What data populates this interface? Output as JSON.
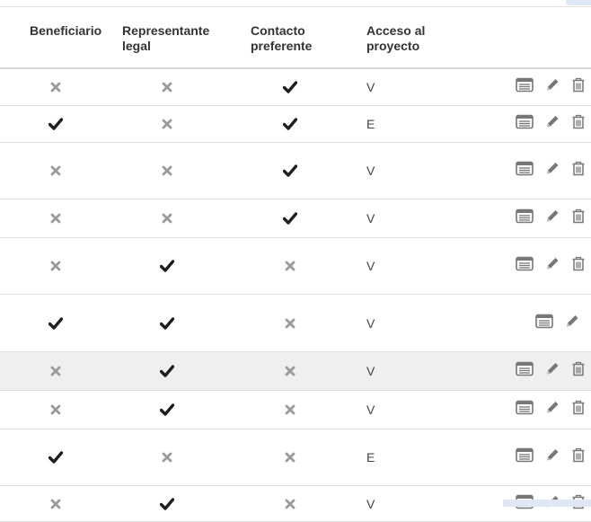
{
  "table": {
    "headers": {
      "beneficiario": "Beneficiario",
      "representante_line1": "Representante",
      "representante_line2": "legal",
      "contacto_line1": "Contacto",
      "contacto_line2": "preferente",
      "acceso_line1": "Acceso al",
      "acceso_line2": "proyecto"
    },
    "rows": [
      {
        "beneficiario": false,
        "representante": false,
        "contacto": true,
        "acceso": "V",
        "icons": [
          "list",
          "edit",
          "delete"
        ],
        "highlight": false
      },
      {
        "beneficiario": true,
        "representante": false,
        "contacto": true,
        "acceso": "E",
        "icons": [
          "list",
          "edit",
          "delete"
        ],
        "highlight": false
      },
      {
        "beneficiario": false,
        "representante": false,
        "contacto": true,
        "acceso": "V",
        "icons": [
          "list",
          "edit",
          "delete"
        ],
        "highlight": false
      },
      {
        "beneficiario": false,
        "representante": false,
        "contacto": true,
        "acceso": "V",
        "icons": [
          "list",
          "edit",
          "delete"
        ],
        "highlight": false
      },
      {
        "beneficiario": false,
        "representante": true,
        "contacto": false,
        "acceso": "V",
        "icons": [
          "list",
          "edit",
          "delete"
        ],
        "highlight": false
      },
      {
        "beneficiario": true,
        "representante": true,
        "contacto": false,
        "acceso": "V",
        "icons": [
          "list",
          "edit"
        ],
        "highlight": false
      },
      {
        "beneficiario": false,
        "representante": true,
        "contacto": false,
        "acceso": "V",
        "icons": [
          "list",
          "edit",
          "delete"
        ],
        "highlight": true
      },
      {
        "beneficiario": false,
        "representante": true,
        "contacto": false,
        "acceso": "V",
        "icons": [
          "list",
          "edit",
          "delete"
        ],
        "highlight": false
      },
      {
        "beneficiario": true,
        "representante": false,
        "contacto": false,
        "acceso": "E",
        "icons": [
          "list",
          "edit",
          "delete"
        ],
        "highlight": false
      },
      {
        "beneficiario": false,
        "representante": true,
        "contacto": false,
        "acceso": "V",
        "icons": [
          "list",
          "edit",
          "delete"
        ],
        "highlight": false
      }
    ]
  },
  "colors": {
    "check": "#1f1f1f",
    "cross": "#9a9a9a",
    "icon": "#777777",
    "highlight_row": "#efefef"
  }
}
